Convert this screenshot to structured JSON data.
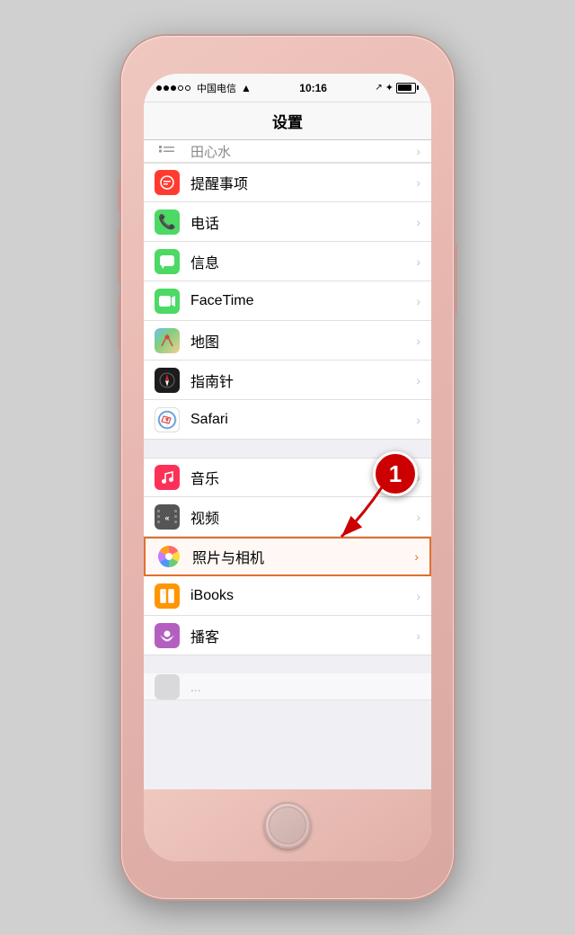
{
  "phone": {
    "status_bar": {
      "carrier": "中国电信",
      "signal_dots": [
        true,
        true,
        true,
        false,
        false
      ],
      "time": "10:16",
      "bluetooth": "✦",
      "battery_level": 85
    },
    "nav_title": "设置",
    "partial_item": {
      "label": "田心水",
      "icon": "list"
    },
    "items_group1": [
      {
        "id": "reminders",
        "icon": "reminders",
        "label": "提醒事项",
        "icon_bg": "#ff3b30",
        "icon_char": "☰"
      },
      {
        "id": "phone",
        "icon": "phone",
        "label": "电话",
        "icon_bg": "#4cd964",
        "icon_char": "📞"
      },
      {
        "id": "messages",
        "icon": "messages",
        "label": "信息",
        "icon_bg": "#4cd964",
        "icon_char": "💬"
      },
      {
        "id": "facetime",
        "icon": "facetime",
        "label": "FaceTime",
        "icon_bg": "#4cd964",
        "icon_char": "📷"
      },
      {
        "id": "maps",
        "icon": "maps",
        "label": "地图",
        "icon_bg": "gradient",
        "icon_char": "🗺"
      },
      {
        "id": "compass",
        "icon": "compass",
        "label": "指南针",
        "icon_bg": "#1c1c1c",
        "icon_char": "🧭"
      },
      {
        "id": "safari",
        "icon": "safari",
        "label": "Safari",
        "icon_bg": "white",
        "icon_char": "🧭"
      }
    ],
    "items_group2": [
      {
        "id": "music",
        "icon": "music",
        "label": "音乐",
        "icon_bg": "#fc3158",
        "icon_char": "♪"
      },
      {
        "id": "videos",
        "icon": "videos",
        "label": "视频",
        "icon_bg": "#555",
        "icon_char": "▶"
      },
      {
        "id": "photos",
        "icon": "photos",
        "label": "照片与相机",
        "icon_bg": "gradient",
        "icon_char": "🌸",
        "highlighted": true
      },
      {
        "id": "ibooks",
        "icon": "ibooks",
        "label": "iBooks",
        "icon_bg": "#ff9500",
        "icon_char": "📖"
      },
      {
        "id": "podcasts",
        "icon": "podcasts",
        "label": "播客",
        "icon_bg": "#b45fc0",
        "icon_char": "🎙"
      }
    ],
    "annotation": {
      "number": "1",
      "arrow_text": "→"
    }
  }
}
